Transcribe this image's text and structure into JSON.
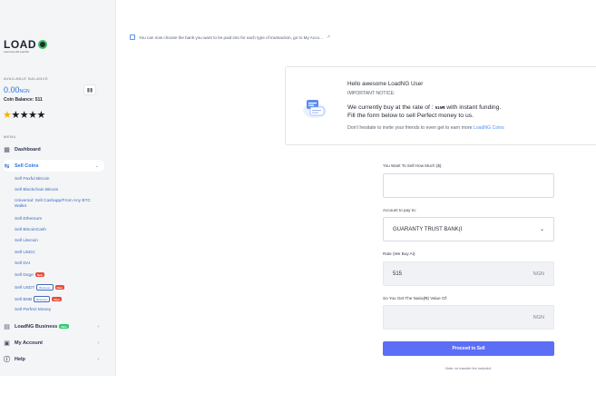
{
  "brand": {
    "logo_text": "LOAD",
    "logo_sub": "Load more with Load NG"
  },
  "balance": {
    "title": "AVAILABLE BALANCE",
    "amount": "0.00",
    "currency": "NGN",
    "coin_balance": "Coin Balance: 511",
    "stars_filled": 5,
    "stars_gold": 1,
    "chart_icon": "bar-chart-icon"
  },
  "menu": {
    "title": "MENU",
    "dashboard": "Dashboard",
    "sell_coins": "Sell Coins",
    "sub_items": [
      "Sell Paxful Bitcoin",
      "Sell Blockchain Bitcoin",
      "Universal: Sell Cashapp/From Any BTC Wallet",
      "Sell Ethereum",
      "Sell BitcoinCash",
      "Sell Litecoin",
      "Sell USDC",
      "Sell DAI",
      "Sell Doge",
      "Sell USDT",
      "Sell BNB",
      "Sell Perfect Money"
    ],
    "tag_new": "New",
    "tag_business": "Business",
    "loadng_business": "LoadNG Business",
    "my_account": "My Account",
    "help": "Help"
  },
  "notice": {
    "text": "You can now choose the bank you want to be paid into for each type of transaction, go to My Acco..."
  },
  "card": {
    "title": "Hello awesome LoadNG User",
    "notice_label": "IMPORTANT NOTICE:",
    "line1_pre": "We currently buy at the rate of : ",
    "line1_rate": "515₦",
    "line1_post": " with instant funding.",
    "line2": "Fill the form below to sell Perfect money to us.",
    "line3_pre": "Don't hesitate to invite your friends to even get to earn more ",
    "line3_link": "LoadNG Coins"
  },
  "form": {
    "amount_label": "You Want To Sell How Much ($).",
    "amount_value": "",
    "account_label": "Account to pay to:",
    "account_value": "GUARANTY TRUST BANK(I",
    "rate_label": "Rate (We Buy At):",
    "rate_value": "515",
    "rate_unit": "NGN",
    "naira_label": "So You Get The Naira(₦) Value Of:",
    "naira_value": "",
    "naira_unit": "NGN",
    "submit": "Proceed to Sell",
    "footnote": "Note: no transfer fee included."
  }
}
